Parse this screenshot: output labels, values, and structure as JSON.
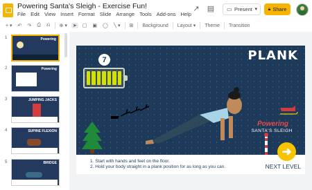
{
  "header": {
    "title": "Powering Santa's Sleigh - Exercise Fun!",
    "menu": [
      "File",
      "Edit",
      "View",
      "Insert",
      "Format",
      "Slide",
      "Arrange",
      "Tools",
      "Add-ons",
      "Help"
    ],
    "present_label": "Present",
    "share_label": "Share"
  },
  "toolbar": {
    "items": [
      "Background",
      "Layout",
      "Theme",
      "Transition"
    ]
  },
  "filmstrip": [
    {
      "num": "1",
      "title": "Powering",
      "selected": true
    },
    {
      "num": "2",
      "title": "Powering"
    },
    {
      "num": "3",
      "title": "JUMPING JACKS"
    },
    {
      "num": "4",
      "title": "SUPINE FLEXION"
    },
    {
      "num": "5",
      "title": "BRIDGE"
    }
  ],
  "slide": {
    "number": "7",
    "title": "PLANK",
    "logo_line1": "Powering",
    "logo_line2": "SANTA'S SLEIGH",
    "instruction_1": "1. Start with hands and feet on the floor.",
    "instruction_2": "2. Hold your body straight in a plank position for as long as you can.",
    "next_level": "NEXT LEVEL",
    "battery_level": 1.0
  },
  "colors": {
    "accent": "#f6b400",
    "slide_bg": "#1e3a5a",
    "battery": "#d4e000"
  }
}
